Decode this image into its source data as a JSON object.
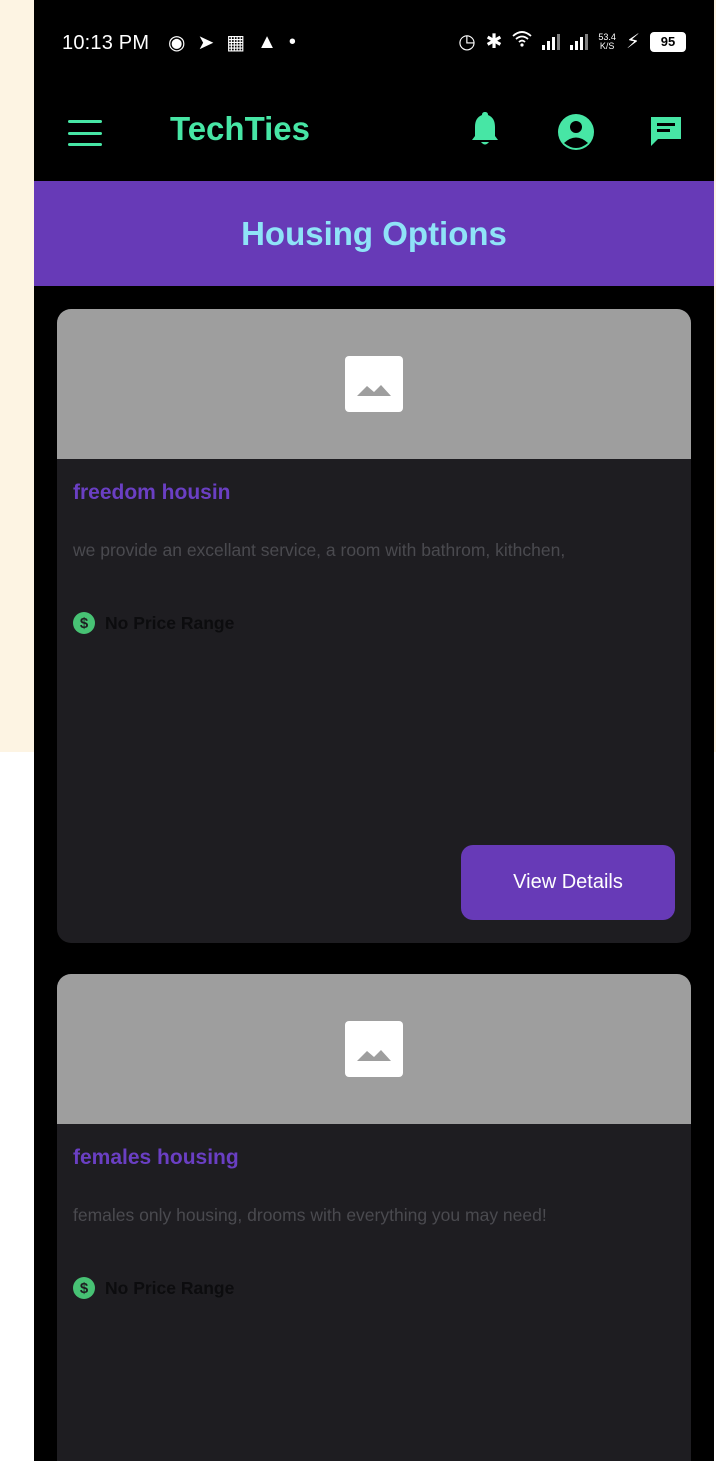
{
  "status_bar": {
    "time": "10:13 PM",
    "net_speed_value": "53.4",
    "net_speed_unit": "K/S",
    "battery": "95",
    "left_icons": [
      "notification-dot-icon",
      "telegram-icon",
      "sim-icon",
      "flame-icon",
      "dot-icon"
    ],
    "right_icons": [
      "alarm-icon",
      "bluetooth-icon",
      "wifi-icon",
      "signal-icon",
      "signal-icon",
      "charging-icon"
    ]
  },
  "app_bar": {
    "title": "TechTies",
    "icons": [
      "menu-icon",
      "bell-icon",
      "account-icon",
      "chat-icon"
    ]
  },
  "header": {
    "title": "Housing Options"
  },
  "housing": [
    {
      "title": "freedom housin",
      "description": "we provide an excellant service, a room with bathrom, kithchen,",
      "price": "No Price Range",
      "button": "View Details"
    },
    {
      "title": "females housing",
      "description": "females only housing, drooms with everything you may need!",
      "price": "No Price Range"
    }
  ],
  "colors": {
    "accent_green": "#47e6a5",
    "purple": "#673ab7",
    "header_title": "#8fe3f7",
    "card_bg": "#1e1d21",
    "image_placeholder": "#9e9e9e",
    "price_icon": "#47c274"
  }
}
